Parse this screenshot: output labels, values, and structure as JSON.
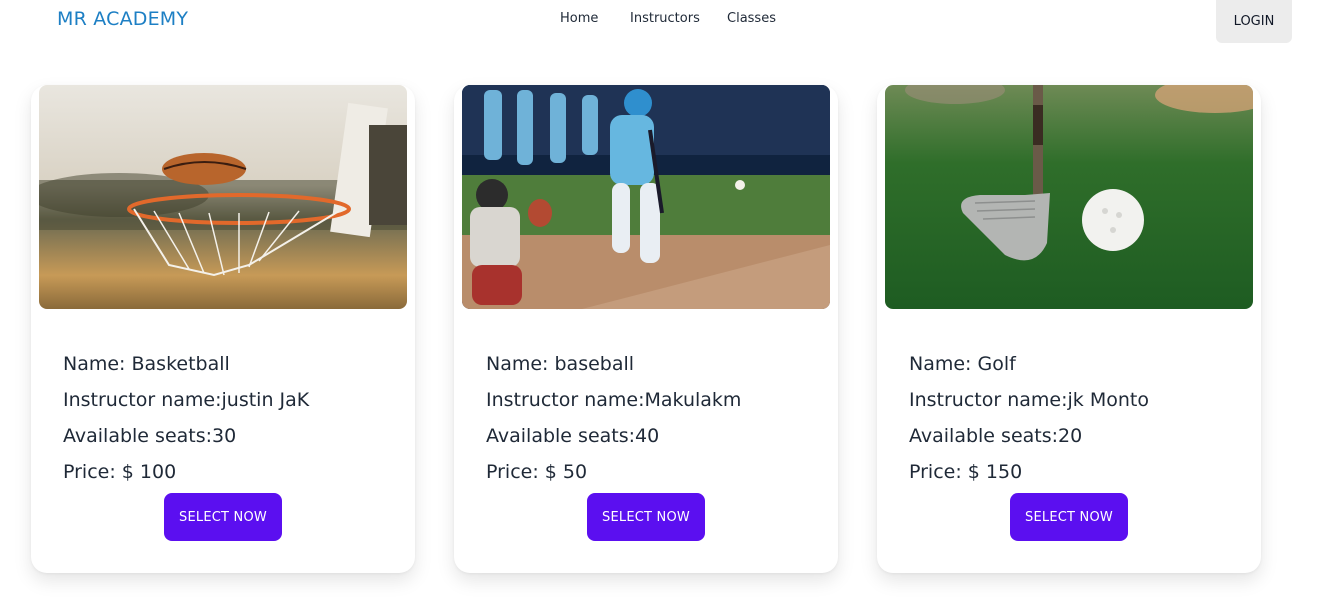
{
  "brand": "MR ACADEMY",
  "nav": {
    "home": "Home",
    "instructors": "Instructors",
    "classes": "Classes",
    "login": "LOGIN"
  },
  "classes": [
    {
      "name": "Name: Basketball",
      "instructor": "Instructor name:justin JaK",
      "seats": "Available seats:30",
      "price": "Price: $ 100",
      "button": "SELECT NOW",
      "image_icon": "basketball-hoop-photo"
    },
    {
      "name": "Name: baseball",
      "instructor": "Instructor name:Makulakm",
      "seats": "Available seats:40",
      "price": "Price: $ 50",
      "button": "SELECT NOW",
      "image_icon": "baseball-batter-photo"
    },
    {
      "name": "Name: Golf",
      "instructor": "Instructor name:jk Monto",
      "seats": "Available seats:20",
      "price": "Price: $ 150",
      "button": "SELECT NOW",
      "image_icon": "golf-club-ball-photo"
    }
  ],
  "colors": {
    "brand": "#1d7fc4",
    "primary_button": "#5b0ff0",
    "login_button_bg": "#ececec"
  }
}
